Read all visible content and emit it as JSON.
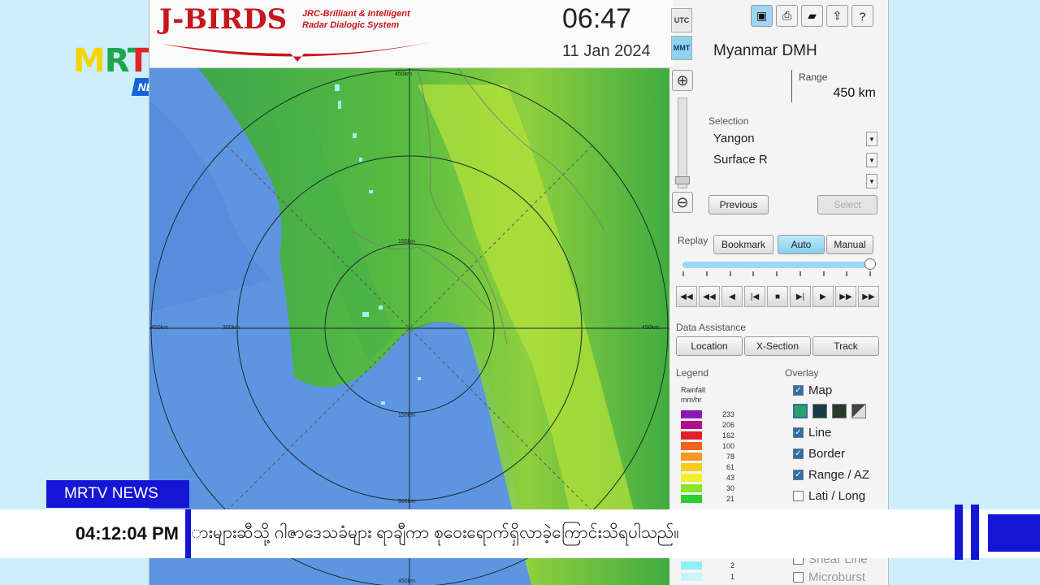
{
  "channel": {
    "logo_text": "MRTV",
    "logo_sub": "NEWS",
    "news_label": "MRTV NEWS",
    "ticker_time": "04:12:04  PM",
    "ticker_text": "ားများဆီသို့  ဂါဇာဒေသခံများ ရာချီကာ စုဝေးရောက်ရှိလာခဲ့ကြောင်းသိရပါသည်။",
    "colors": {
      "accent": "#1515d6",
      "news_badge": "#1565d8"
    }
  },
  "radar_app": {
    "brand": "J-BIRDS",
    "brand_sub_1": "JRC-Brilliant & Intelligent",
    "brand_sub_2": "Radar Dialogic System",
    "time": "06:47",
    "date": "11 Jan 2024",
    "tz_utc": "UTC",
    "tz_mmt": "MMT",
    "toolbar_icons": [
      "save-icon",
      "print-icon",
      "folder-icon",
      "export-icon",
      "help-icon"
    ],
    "station": "Myanmar DMH",
    "range_label": "Range",
    "range_value": "450 km",
    "selection_label": "Selection",
    "selection_site": "Yangon",
    "selection_product": "Surface R",
    "selection_extra": "",
    "previous_label": "Previous",
    "select_label": "Select",
    "replay_label": "Replay",
    "bookmark_label": "Bookmark",
    "auto_label": "Auto",
    "manual_label": "Manual",
    "data_assist_label": "Data Assistance",
    "location_label": "Location",
    "xsection_label": "X-Section",
    "track_label": "Track",
    "legend_label": "Legend",
    "legend_units_1": "Rainfall",
    "legend_units_2": "mm/hr",
    "legend": [
      {
        "value": "233",
        "color": "#8a18b8"
      },
      {
        "value": "206",
        "color": "#b0108c"
      },
      {
        "value": "162",
        "color": "#e0202a"
      },
      {
        "value": "100",
        "color": "#f0621e"
      },
      {
        "value": "78",
        "color": "#f29a22"
      },
      {
        "value": "61",
        "color": "#f4cd1e"
      },
      {
        "value": "43",
        "color": "#f0f028"
      },
      {
        "value": "30",
        "color": "#88e62a"
      },
      {
        "value": "21",
        "color": "#2ccf2a"
      },
      {
        "value": "2",
        "color": "#8ef0f4"
      },
      {
        "value": "1",
        "color": "#c8f6f8"
      }
    ],
    "overlay_label": "Overlay",
    "overlay_map": "Map",
    "overlay_line": "Line",
    "overlay_border": "Border",
    "overlay_range": "Range / AZ",
    "overlay_latlong": "Lati / Long",
    "overlay_shear": "Shear Line",
    "overlay_microburst": "Microburst",
    "map_labels": {
      "r150_top": "150km",
      "r450_top": "450km",
      "r450_left": "450km",
      "r300_left": "300km",
      "r150_bottom": "150km",
      "r300_bottom": "300km",
      "r450_bottom": "450km",
      "r450_right": "450km"
    }
  }
}
